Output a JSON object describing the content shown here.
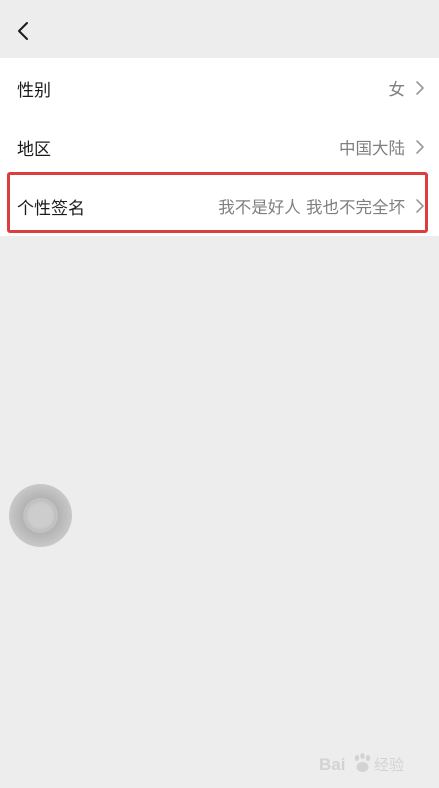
{
  "header": {
    "back_icon": "chevron-left-icon"
  },
  "rows": [
    {
      "label": "性别",
      "value": "女"
    },
    {
      "label": "地区",
      "value": "中国大陆"
    },
    {
      "label": "个性签名",
      "value": "我不是好人 我也不完全坏"
    }
  ],
  "overlays": {
    "highlight_color": "#dc3d3d",
    "watermark_text": "Bai 经验"
  },
  "colors": {
    "background": "#ededed",
    "card": "#ffffff",
    "label": "#1a1a1a",
    "value": "#7f7f7f"
  }
}
